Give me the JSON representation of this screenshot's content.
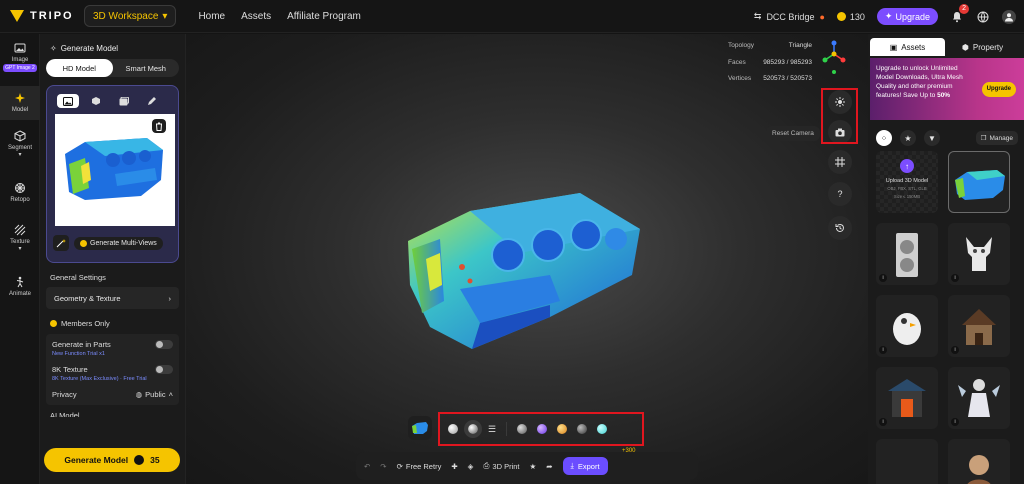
{
  "app": {
    "name": "TRIPO"
  },
  "topbar": {
    "workspace": "3D Workspace",
    "nav": [
      "Home",
      "Assets",
      "Affiliate Program"
    ],
    "dcc_bridge": "DCC Bridge",
    "credits": "130",
    "upgrade": "Upgrade",
    "notification_count": "2"
  },
  "rail": {
    "items": [
      {
        "label": "Image",
        "tag": "GPT Image 2"
      },
      {
        "label": "Model"
      },
      {
        "label": "Segment"
      },
      {
        "label": "Retopo"
      },
      {
        "label": "Texture"
      },
      {
        "label": "Animate"
      }
    ]
  },
  "panel": {
    "title": "Generate Model",
    "modes": [
      "HD Model",
      "Smart Mesh"
    ],
    "generate_multiviews": "Generate Multi-Views",
    "general_settings": "General Settings",
    "geometry_texture": "Geometry & Texture",
    "members_only": "Members Only",
    "generate_in_parts": "Generate in Parts",
    "generate_in_parts_sub": "New Function Trial x1",
    "texture_8k": "8K Texture",
    "texture_8k_sub": "8K Texture (Max Exclusive) · Free Trial",
    "privacy": "Privacy",
    "privacy_value": "Public",
    "ai_model_cut": "AI Model",
    "generate_button": "Generate Model",
    "generate_cost": "35"
  },
  "viewport": {
    "stats": [
      {
        "label": "Topology",
        "value": "Triangle"
      },
      {
        "label": "Faces",
        "value": "985293 / 985293"
      },
      {
        "label": "Vertices",
        "value": "520573 / 520573"
      }
    ],
    "reset_camera": "Reset Camera",
    "help": "?"
  },
  "bottom_bar": {
    "free_retry": "Free Retry",
    "print_3d": "3D Print",
    "export": "Export",
    "bonus": "+300"
  },
  "materials": {
    "colors": [
      "#d8d8d8",
      "#9a9a9a",
      "#8f8f8f",
      "#8a4dff",
      "#f0a020",
      "#7a7a7a",
      "#5fe0e0"
    ]
  },
  "rpanel": {
    "tabs": [
      "Assets",
      "Property"
    ],
    "promo_text": "Upgrade to unlock Unlimited Model Downloads, Ultra Mesh Quality and other premium features! Save Up to",
    "promo_percent": "50%",
    "promo_button": "Upgrade",
    "manage": "Manage",
    "upload_title": "Upload 3D Model",
    "upload_formats": "OBJ, FBX, STL, GLB",
    "upload_size": "Size ≤ 150MB"
  }
}
